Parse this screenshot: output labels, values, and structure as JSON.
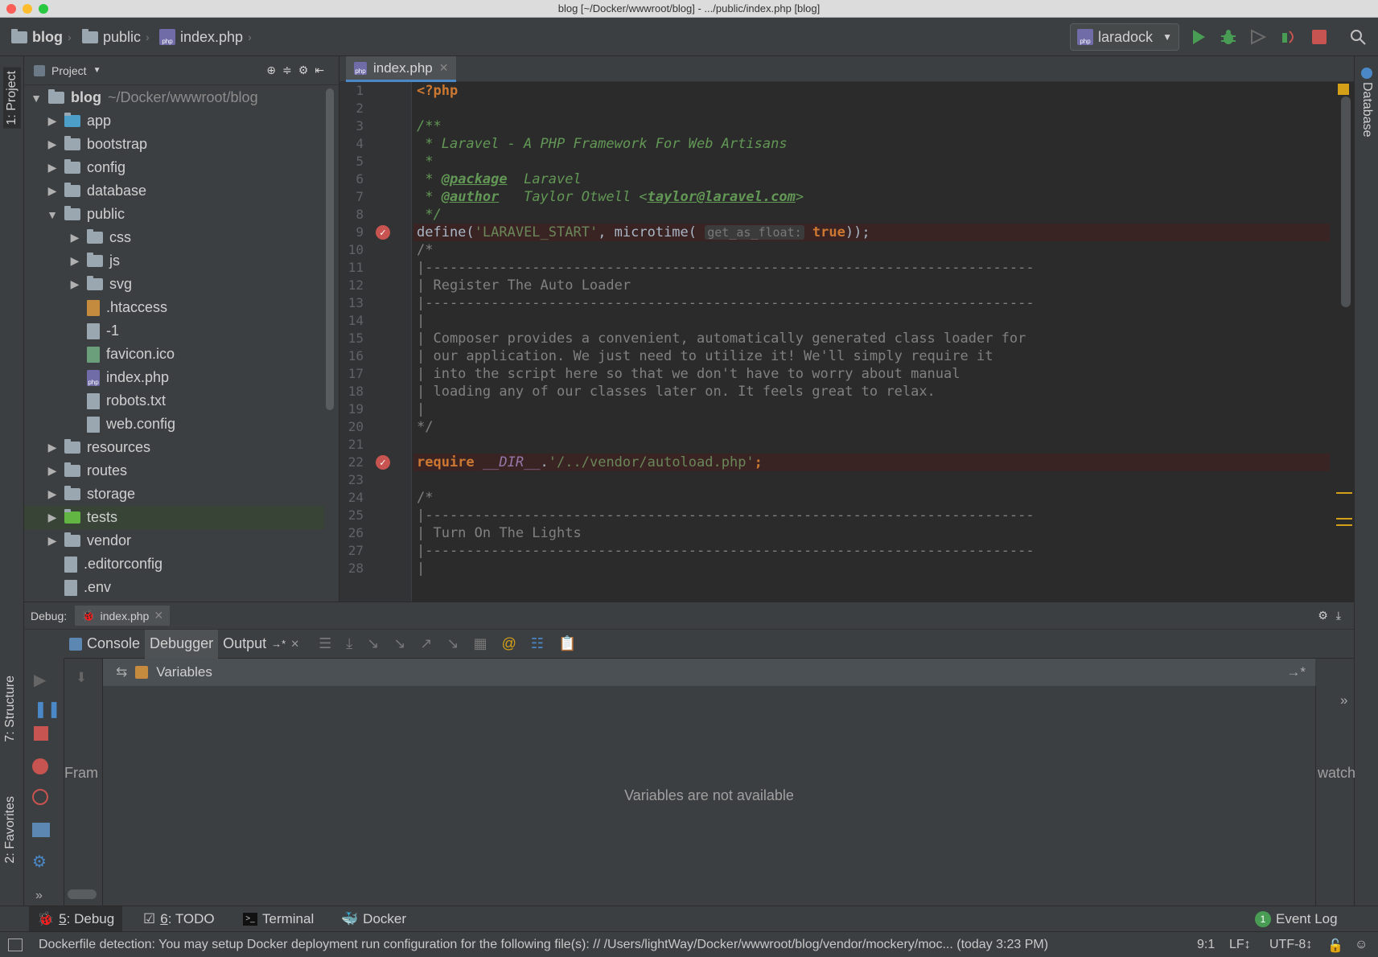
{
  "window": {
    "title": "blog [~/Docker/wwwroot/blog] - .../public/index.php [blog]"
  },
  "navbar": {
    "crumbs": [
      "blog",
      "public",
      "index.php"
    ],
    "run_config": "laradock"
  },
  "project_panel": {
    "header": "Project",
    "root_name": "blog",
    "root_path": "~/Docker/wwwroot/blog",
    "items": [
      "app",
      "bootstrap",
      "config",
      "database",
      "public",
      "css",
      "js",
      "svg",
      ".htaccess",
      "-1",
      "favicon.ico",
      "index.php",
      "robots.txt",
      "web.config",
      "resources",
      "routes",
      "storage",
      "tests",
      "vendor",
      ".editorconfig",
      ".env"
    ]
  },
  "editor": {
    "tab": "index.php",
    "line_numbers": [
      "1",
      "2",
      "3",
      "4",
      "5",
      "6",
      "7",
      "8",
      "9",
      "10",
      "11",
      "12",
      "13",
      "14",
      "15",
      "16",
      "17",
      "18",
      "19",
      "20",
      "21",
      "22",
      "23",
      "24",
      "25",
      "26",
      "27",
      "28"
    ],
    "lines": {
      "l1": "<?php",
      "l3": "/**",
      "l4": " * Laravel - A PHP Framework For Web Artisans",
      "l5": " *",
      "l6a": " * ",
      "l6b": "@package",
      "l6c": "  Laravel",
      "l7a": " * ",
      "l7b": "@author",
      "l7c": "   Taylor Otwell <",
      "l7d": "taylor@laravel.com",
      "l7e": ">",
      "l8": " */",
      "l9a": "define(",
      "l9b": "'LARAVEL_START'",
      "l9c": ", microtime( ",
      "l9hint": "get_as_float:",
      "l9d": " true",
      "l9e": "));",
      "l10": "/*",
      "l11": "|--------------------------------------------------------------------------",
      "l12": "| Register The Auto Loader",
      "l13": "|--------------------------------------------------------------------------",
      "l14": "|",
      "l15": "| Composer provides a convenient, automatically generated class loader for",
      "l16": "| our application. We just need to utilize it! We'll simply require it",
      "l17": "| into the script here so that we don't have to worry about manual",
      "l18": "| loading any of our classes later on. It feels great to relax.",
      "l19": "|",
      "l20": "*/",
      "l22a": "require ",
      "l22b": "__DIR__",
      "l22c": ".",
      "l22d": "'/../vendor/autoload.php'",
      "l22e": ";",
      "l24": "/*",
      "l25": "|--------------------------------------------------------------------------",
      "l26": "| Turn On The Lights",
      "l27": "|--------------------------------------------------------------------------",
      "l28": "|"
    }
  },
  "right_strip": {
    "database_label": "Database"
  },
  "left_strip": {
    "project_label": "1: Project",
    "structure_label": "7: Structure",
    "favorites_label": "2: Favorites"
  },
  "debug": {
    "label": "Debug:",
    "session_tab": "index.php",
    "tabs": {
      "console": "Console",
      "debugger": "Debugger",
      "output": "Output"
    },
    "variables_header": "Variables",
    "variables_empty": "Variables are not available",
    "frames_label": "Fram",
    "watches_label": "watch"
  },
  "bottom_tools": {
    "debug_num": "5",
    "debug": ": Debug",
    "todo_num": "6",
    "todo": ": TODO",
    "terminal": "Terminal",
    "docker": "Docker",
    "event_log": "Event Log",
    "event_count": "1"
  },
  "statusbar": {
    "message": "Dockerfile detection: You may setup Docker deployment run configuration for the following file(s): // /Users/lightWay/Docker/wwwroot/blog/vendor/mockery/moc... (today 3:23 PM)",
    "position": "9:1",
    "line_sep": "LF↕",
    "encoding": "UTF-8↕"
  },
  "colors": {
    "accent": "#4a88c7",
    "breakpoint": "#c75450",
    "run": "#499c54"
  }
}
